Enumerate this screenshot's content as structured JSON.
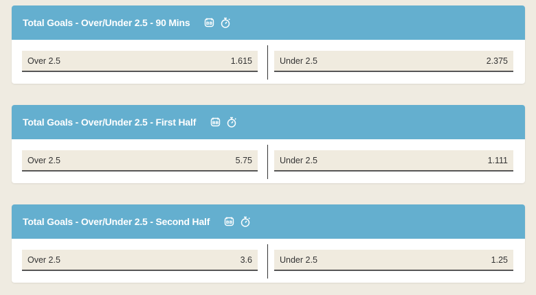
{
  "markets": [
    {
      "title": "Total Goals - Over/Under 2.5 - 90 Mins",
      "selections": [
        {
          "label": "Over 2.5",
          "odds": "1.615"
        },
        {
          "label": "Under 2.5",
          "odds": "2.375"
        }
      ]
    },
    {
      "title": "Total Goals - Over/Under 2.5 - First Half",
      "selections": [
        {
          "label": "Over 2.5",
          "odds": "5.75"
        },
        {
          "label": "Under 2.5",
          "odds": "1.111"
        }
      ]
    },
    {
      "title": "Total Goals - Over/Under 2.5 - Second Half",
      "selections": [
        {
          "label": "Over 2.5",
          "odds": "3.6"
        },
        {
          "label": "Under 2.5",
          "odds": "1.25"
        }
      ]
    }
  ],
  "icons": {
    "build_bet": "build-bet-icon",
    "timer": "stopwatch-icon"
  },
  "colors": {
    "header_bg": "#64afcf",
    "page_bg": "#efebe1",
    "selection_bg": "#f0ebdf"
  }
}
